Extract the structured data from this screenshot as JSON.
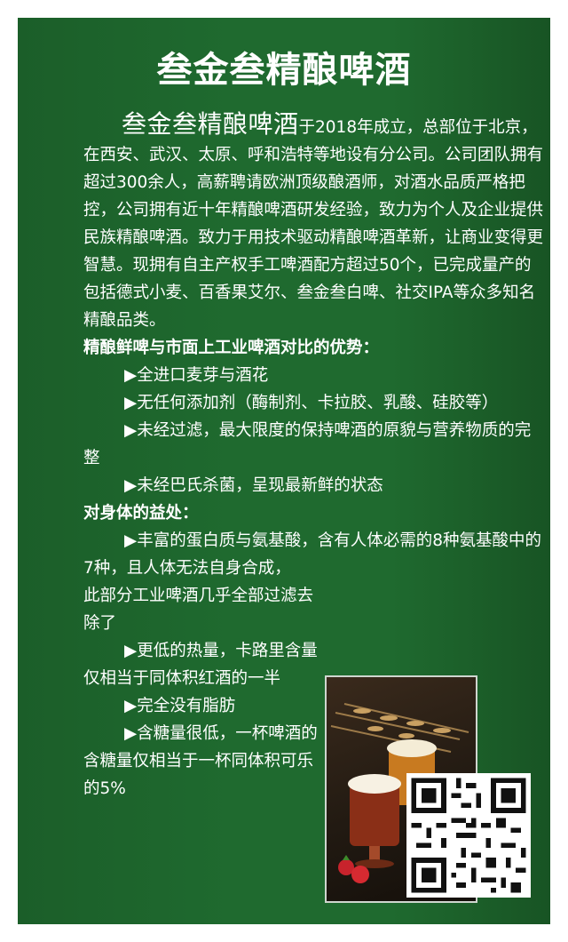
{
  "title": "叁金叁精酿啤酒",
  "intro": {
    "brand": "叁金叁精酿啤酒",
    "text": "于2018年成立，总部位于北京，在西安、武汉、太原、呼和浩特等地设有分公司。公司团队拥有超过300余人，高薪聘请欧洲顶级酿酒师，对酒水品质严格把控，公司拥有近十年精酿啤酒研发经验，致力为个人及企业提供民族精酿啤酒。致力于用技术驱动精酿啤酒革新，让商业变得更智慧。现拥有自主产权手工啤酒配方超过50个，已完成量产的包括德式小麦、百香果艾尔、叁金叁白啤、社交IPA等众多知名精酿品类。"
  },
  "advantages": {
    "heading": "精酿鲜啤与市面上工业啤酒对比的优势：",
    "items": [
      "▶全进口麦芽与酒花",
      "▶无任何添加剂（酶制剂、卡拉胶、乳酸、硅胶等）",
      "▶未经过滤，最大限度的保持啤酒的原貌与营养物质的完整",
      "▶未经巴氏杀菌，呈现最新鲜的状态"
    ]
  },
  "benefits": {
    "heading": "对身体的益处：",
    "items": [
      "▶丰富的蛋白质与氨基酸，含有人体必需的8种氨基酸中的7种，且人体无法自身合成，",
      "此部分工业啤酒几乎全部过滤去除了",
      "▶更低的热量，卡路里含量仅相当于同体积红酒的一半",
      "▶完全没有脂肪",
      "▶含糖量很低，一杯啤酒的含糖量仅相当于一杯同体积可乐的5%"
    ]
  },
  "colors": {
    "background": "#1f6a2f",
    "text": "#ffffff"
  }
}
